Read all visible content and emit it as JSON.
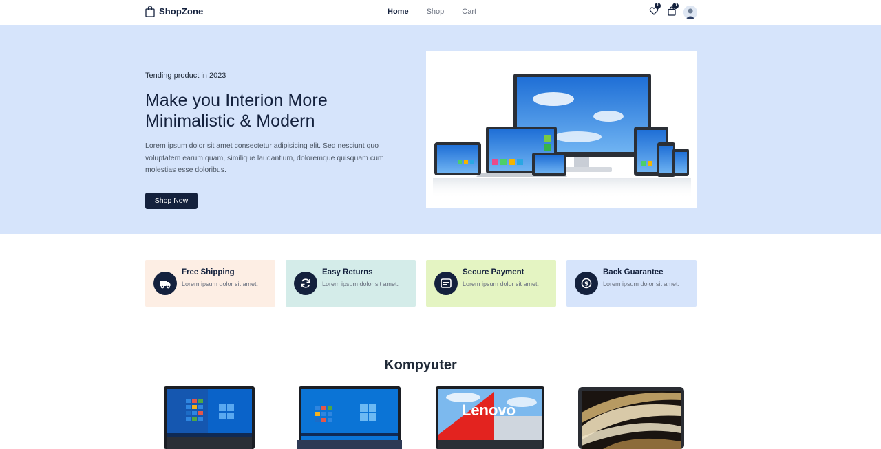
{
  "navbar": {
    "brand": "ShopZone",
    "links": [
      "Home",
      "Shop",
      "Cart"
    ],
    "wishlist_count": "1",
    "cart_count": "0"
  },
  "hero": {
    "eyebrow": "Tending product in 2023",
    "title_line1": "Make you Interion More",
    "title_line2": "Minimalistic & Modern",
    "description": "Lorem ipsum dolor sit amet consectetur adipisicing elit. Sed nesciunt quo voluptatem earum quam, similique laudantium, doloremque quisquam cum molestias esse doloribus.",
    "button": "Shop Now"
  },
  "features": [
    {
      "title": "Free Shipping",
      "desc": "Lorem ipsum dolor sit amet.",
      "bg": "#fdeee4",
      "icon": "truck-icon"
    },
    {
      "title": "Easy Returns",
      "desc": "Lorem ipsum dolor sit amet.",
      "bg": "#d4ece9",
      "icon": "refresh-icon"
    },
    {
      "title": "Secure Payment",
      "desc": "Lorem ipsum dolor sit amet.",
      "bg": "#e4f4c2",
      "icon": "card-icon"
    },
    {
      "title": "Back Guarantee",
      "desc": "Lorem ipsum dolor sit amet.",
      "bg": "#d6e4fb",
      "icon": "money-back-icon"
    }
  ],
  "section": {
    "title": "Kompyuter"
  },
  "products": [
    {
      "name": "laptop-windows-silver"
    },
    {
      "name": "laptop-windows-blue"
    },
    {
      "name": "laptop-lenovo",
      "screen_text": "Lenovo"
    },
    {
      "name": "laptop-macbook"
    }
  ],
  "colors": {
    "navy": "#14213d",
    "hero_bg": "#d6e4fb"
  }
}
